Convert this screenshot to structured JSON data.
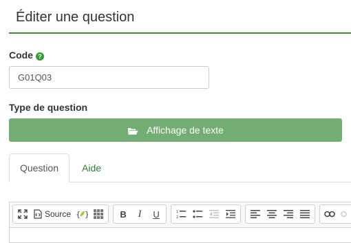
{
  "page": {
    "title": "Éditer une question"
  },
  "code": {
    "label": "Code",
    "help_icon_glyph": "?",
    "value": "G01Q03"
  },
  "question_type": {
    "label": "Type de question",
    "button_label": "Affichage de texte",
    "icon": "folder-open-icon",
    "color": "#74ad74"
  },
  "tabs": [
    {
      "label": "Question",
      "active": true
    },
    {
      "label": "Aide",
      "active": false
    }
  ],
  "editor": {
    "source_label": "Source",
    "bold_label": "B",
    "italic_label": "I",
    "underline_label": "U"
  },
  "colors": {
    "accent": "#3d8b3d",
    "link": "#2e7d32"
  }
}
